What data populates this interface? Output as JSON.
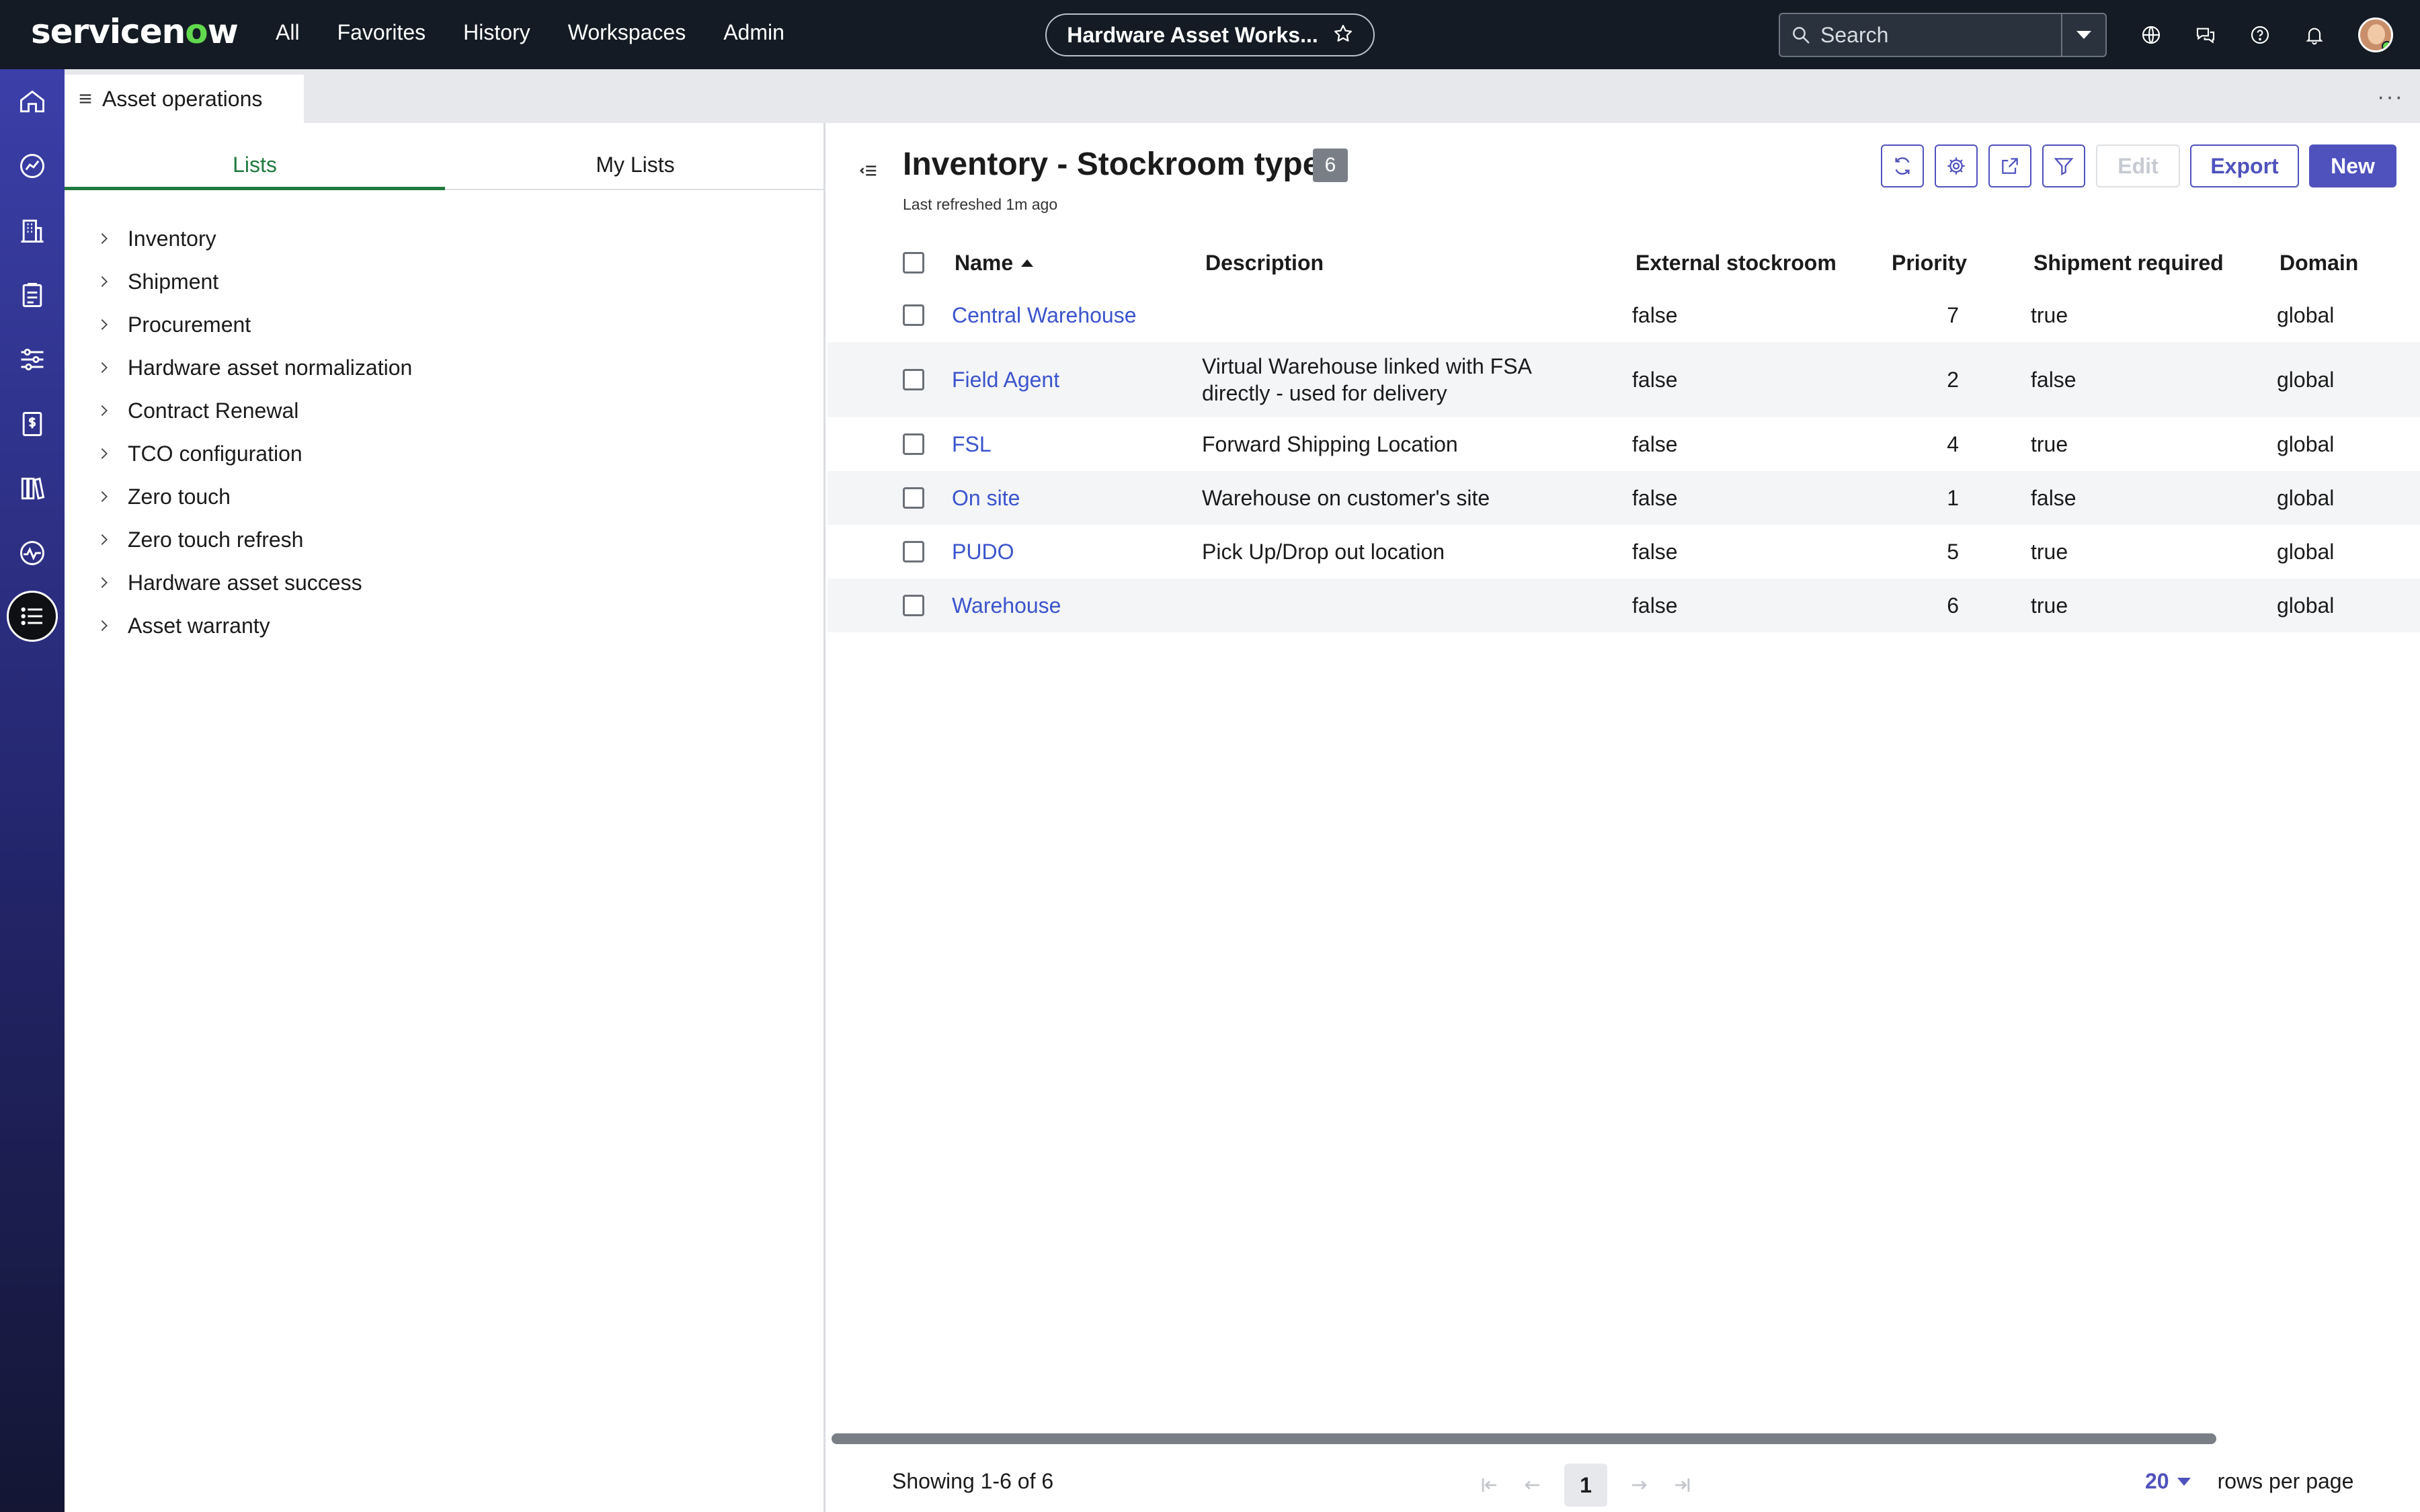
{
  "app": {
    "logo": {
      "part1": "servicen",
      "o": "o",
      "part2": "w"
    },
    "nav": [
      "All",
      "Favorites",
      "History",
      "Workspaces",
      "Admin"
    ],
    "workspace_title": "Hardware Asset Works...",
    "search": {
      "placeholder": "Search"
    },
    "icons": [
      "globe-icon",
      "chat-icon",
      "help-icon",
      "bell-icon"
    ]
  },
  "rail": [
    "home-icon",
    "dashboard-icon",
    "building-icon",
    "clipboard-icon",
    "sliders-icon",
    "billing-icon",
    "books-icon",
    "activity-icon",
    "list-icon"
  ],
  "tab": {
    "label": "Asset operations",
    "more": "···"
  },
  "left_panel": {
    "tabs": [
      "Lists",
      "My Lists"
    ],
    "active_tab": "Lists",
    "items": [
      "Inventory",
      "Shipment",
      "Procurement",
      "Hardware asset normalization",
      "Contract Renewal",
      "TCO configuration",
      "Zero touch",
      "Zero touch refresh",
      "Hardware asset success",
      "Asset warranty"
    ]
  },
  "list": {
    "title": "Inventory - Stockroom types",
    "count": "6",
    "refreshed": "Last refreshed 1m ago",
    "buttons": {
      "edit": "Edit",
      "export": "Export",
      "new": "New"
    },
    "columns": [
      "Name",
      "Description",
      "External stockroom",
      "Priority",
      "Shipment required",
      "Domain"
    ],
    "rows": [
      {
        "name": "Central Warehouse",
        "desc1": "",
        "desc2": "",
        "external": "false",
        "priority": "7",
        "shipment": "true",
        "domain": "global"
      },
      {
        "name": "Field Agent",
        "desc1": "Virtual Warehouse linked with FSA",
        "desc2": "directly - used for delivery",
        "external": "false",
        "priority": "2",
        "shipment": "false",
        "domain": "global"
      },
      {
        "name": "FSL",
        "desc1": "Forward Shipping Location",
        "desc2": "",
        "external": "false",
        "priority": "4",
        "shipment": "true",
        "domain": "global"
      },
      {
        "name": "On site",
        "desc1": "Warehouse on customer's site",
        "desc2": "",
        "external": "false",
        "priority": "1",
        "shipment": "false",
        "domain": "global"
      },
      {
        "name": "PUDO",
        "desc1": "Pick Up/Drop out location",
        "desc2": "",
        "external": "false",
        "priority": "5",
        "shipment": "true",
        "domain": "global"
      },
      {
        "name": "Warehouse",
        "desc1": "",
        "desc2": "",
        "external": "false",
        "priority": "6",
        "shipment": "true",
        "domain": "global"
      }
    ],
    "footer": {
      "showing": "Showing 1-6 of 6",
      "page": "1",
      "rows_per_page_value": "20",
      "rows_per_page_label": "rows per page"
    }
  },
  "colors": {
    "accent": "#4f52bd",
    "link": "#3b54cc",
    "topbar": "#141b24",
    "lists_tab": "#1f7a3d"
  }
}
